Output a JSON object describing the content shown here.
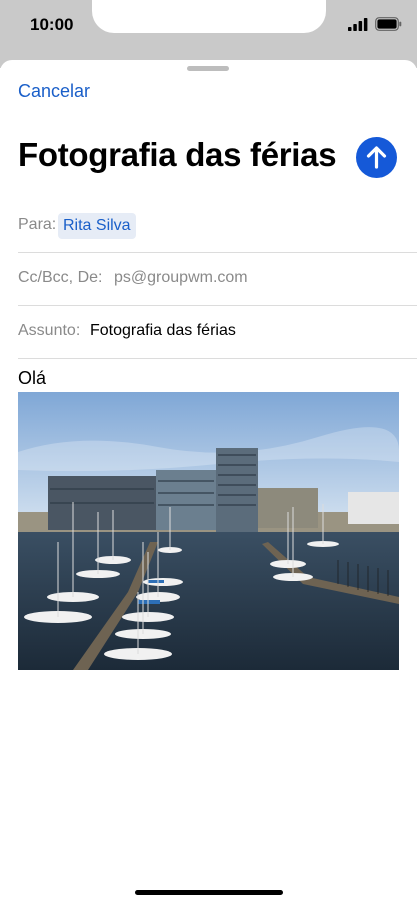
{
  "status": {
    "time": "10:00"
  },
  "compose": {
    "cancel_label": "Cancelar",
    "title": "Fotografia das férias",
    "to_label": "Para:",
    "to_recipient": "Rita Silva",
    "ccbcc_label": "Cc/Bcc, De:",
    "from_address": "ps@groupwm.com",
    "subject_label": "Assunto:",
    "subject_value": "Fotografia das férias",
    "body_text": "Olá"
  },
  "colors": {
    "accent": "#1559d8",
    "link": "#1a5fc9",
    "status_bg": "#c9c9c9"
  },
  "icons": {
    "send": "arrow-up-icon",
    "signal": "signal-icon",
    "battery": "battery-icon"
  }
}
